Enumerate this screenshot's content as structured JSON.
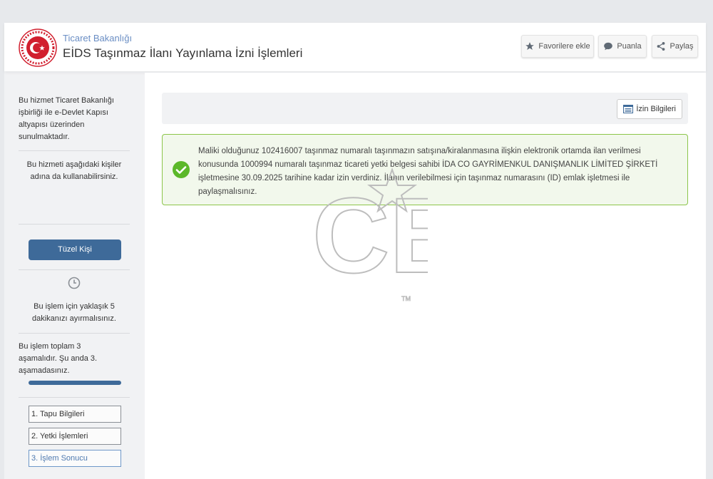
{
  "header": {
    "ministry": "Ticaret Bakanlığı",
    "service_title": "EİDS Taşınmaz İlanı Yayınlama İzni İşlemleri",
    "buttons": {
      "favorite": "Favorilere ekle",
      "rate": "Puanla",
      "share": "Paylaş"
    }
  },
  "sidebar": {
    "info": "Bu hizmet Ticaret Bakanlığı işbirliği ile e-Devlet Kapısı altyapısı üzerinden sunulmaktadır.",
    "usable_for": "Bu hizmeti aşağıdaki kişiler adına da kullanabilirsiniz.",
    "tuzel_label": "Tüzel Kişi",
    "duration": "Bu işlem için yaklaşık 5 dakikanızı ayırmalısınız.",
    "stage_info": "Bu işlem toplam 3 aşamalıdır. Şu anda 3. aşamadasınız.",
    "progress": 1.0,
    "steps": [
      {
        "label": "1. Tapu Bilgileri",
        "active": false
      },
      {
        "label": "2. Yetki İşlemleri",
        "active": false
      },
      {
        "label": "3. İşlem Sonucu",
        "active": true
      }
    ]
  },
  "main": {
    "izin_button": "İzin Bilgileri",
    "alert_message": "Maliki olduğunuz 102416007 taşınmaz numaralı taşınmazın satışına/kiralanmasına ilişkin elektronik ortamda ilan verilmesi konusunda 1000994 numaralı taşınmaz ticareti yetki belgesi sahibi İDA CO GAYRİMENKUL DANIŞMANLIK LİMİTED ŞİRKETİ işletmesine 30.09.2025 tarihine kadar izin verdiniz. İlanın verilebilmesi için taşınmaz numarasını (ID) emlak işletmesi ile paylaşmalısınız."
  },
  "watermark": {
    "text": "CB",
    "mark": "TM"
  },
  "colors": {
    "accent": "#3e6a99",
    "success_border": "#8cc54a",
    "success_icon": "#5cb82a",
    "logo_red": "#d11f2e"
  },
  "icons": [
    "ministry-logo",
    "star-icon",
    "comment-icon",
    "share-icon",
    "clock-icon",
    "list-icon",
    "check-circle-icon"
  ]
}
